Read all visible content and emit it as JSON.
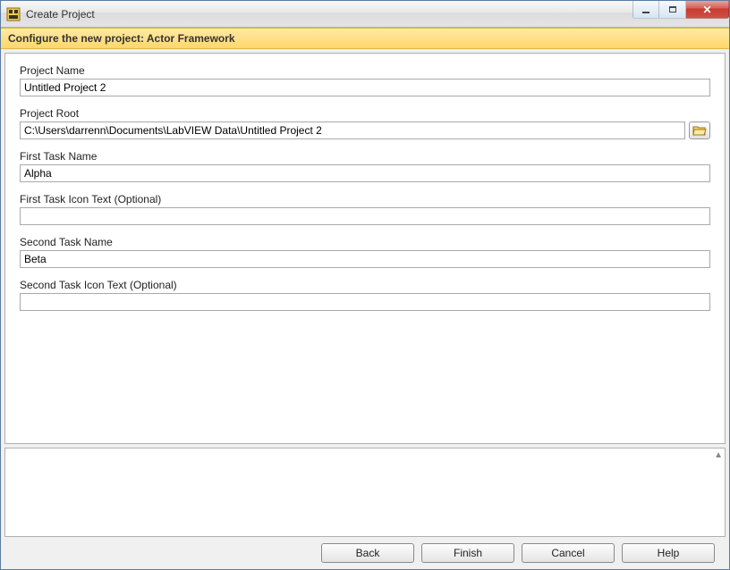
{
  "window": {
    "title": "Create Project",
    "subtitle": "Configure the new project: Actor Framework"
  },
  "fields": {
    "projectName": {
      "label": "Project Name",
      "value": "Untitled Project 2"
    },
    "projectRoot": {
      "label": "Project Root",
      "value": "C:\\Users\\darrenn\\Documents\\LabVIEW Data\\Untitled Project 2"
    },
    "firstTaskName": {
      "label": "First Task Name",
      "value": "Alpha"
    },
    "firstTaskIcon": {
      "label": "First Task Icon Text (Optional)",
      "value": ""
    },
    "secondTaskName": {
      "label": "Second Task Name",
      "value": "Beta"
    },
    "secondTaskIcon": {
      "label": "Second Task Icon Text (Optional)",
      "value": ""
    }
  },
  "buttons": {
    "back": "Back",
    "finish": "Finish",
    "cancel": "Cancel",
    "help": "Help"
  }
}
